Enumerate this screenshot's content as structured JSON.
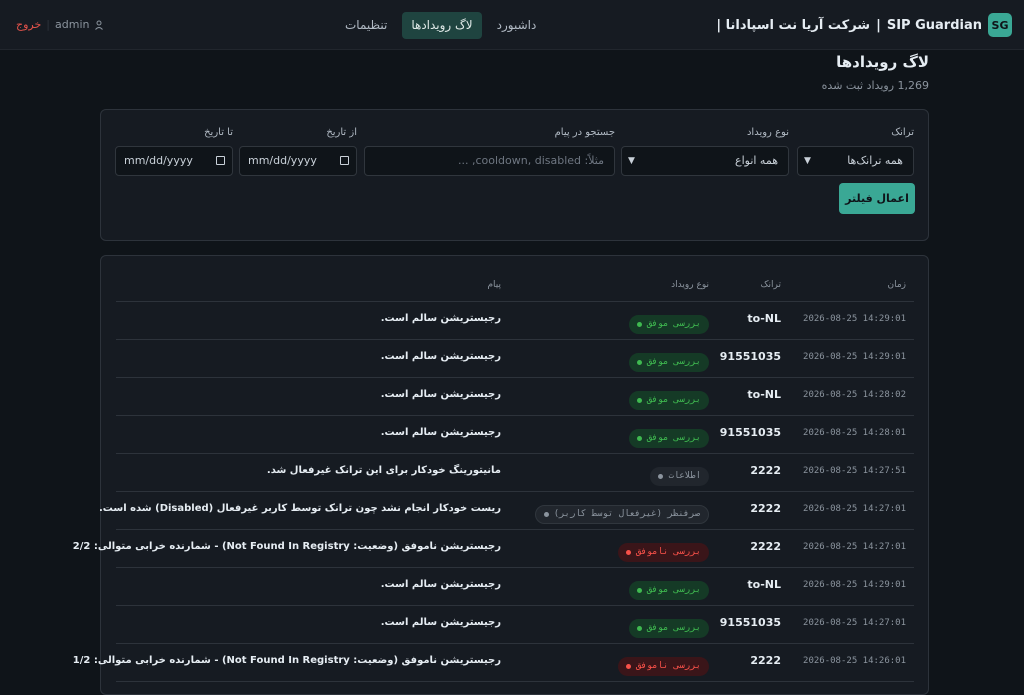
{
  "brand": {
    "logo": "SG",
    "name": "SIP Guardian",
    "separator": "|",
    "company": "شرکت آریا نت اسپادانا |"
  },
  "nav": {
    "tabs": [
      {
        "label": "داشبورد"
      },
      {
        "label": "لاگ رویدادها"
      },
      {
        "label": "تنظیمات"
      }
    ],
    "active_index": 1
  },
  "user": {
    "logout": "خروج",
    "name": "admin",
    "separator": "|",
    "icon": "user-icon"
  },
  "page": {
    "title": "لاگ رویدادها",
    "subtitle": "1,269 رویداد ثبت شده"
  },
  "filters": {
    "trunk": {
      "label": "ترانک",
      "value": "همه ترانک‌ها"
    },
    "type": {
      "label": "نوع رویداد",
      "value": "همه انواع"
    },
    "search": {
      "label": "جستجو در پیام",
      "placeholder": "مثلاً: cooldown, disabled, ..."
    },
    "from": {
      "label": "از تاریخ",
      "value": "mm/dd/yyyy"
    },
    "to": {
      "label": "تا تاریخ",
      "value": "mm/dd/yyyy"
    },
    "apply": "اعمال فیلتر"
  },
  "table": {
    "headers": {
      "time": "زمان",
      "trunk": "ترانک",
      "type": "نوع رویداد",
      "message": "پیام"
    },
    "rows": [
      {
        "time": "2026-08-25 14:29:01",
        "trunk": "to-NL",
        "type": "بررسی موفق",
        "status": "success",
        "message": "رجیستریشن سالم است."
      },
      {
        "time": "2026-08-25 14:29:01",
        "trunk": "91551035",
        "type": "بررسی موفق",
        "status": "success",
        "message": "رجیستریشن سالم است."
      },
      {
        "time": "2026-08-25 14:28:02",
        "trunk": "to-NL",
        "type": "بررسی موفق",
        "status": "success",
        "message": "رجیستریشن سالم است."
      },
      {
        "time": "2026-08-25 14:28:01",
        "trunk": "91551035",
        "type": "بررسی موفق",
        "status": "success",
        "message": "رجیستریشن سالم است."
      },
      {
        "time": "2026-08-25 14:27:51",
        "trunk": "2222",
        "type": "اطلاعات",
        "status": "info",
        "message": "مانیتورینگ خودکار برای این ترانک غیرفعال شد."
      },
      {
        "time": "2026-08-25 14:27:01",
        "trunk": "2222",
        "type": "صرفنظر (غیرفعال توسط کاربر)",
        "status": "skip",
        "message": "ریست خودکار انجام نشد چون ترانک توسط کاربر غیرفعال (Disabled) شده است."
      },
      {
        "time": "2026-08-25 14:27:01",
        "trunk": "2222",
        "type": "بررسی ناموفق",
        "status": "error",
        "message": "رجیستریشن ناموفق (وضعیت: Not Found In Registry) - شمارنده خرابی متوالی: 2/2"
      },
      {
        "time": "2026-08-25 14:29:01",
        "trunk": "to-NL",
        "type": "بررسی موفق",
        "status": "success",
        "message": "رجیستریشن سالم است."
      },
      {
        "time": "2026-08-25 14:27:01",
        "trunk": "91551035",
        "type": "بررسی موفق",
        "status": "success",
        "message": "رجیستریشن سالم است."
      },
      {
        "time": "2026-08-25 14:26:01",
        "trunk": "2222",
        "type": "بررسی ناموفق",
        "status": "error",
        "message": "رجیستریشن ناموفق (وضعیت: Not Found In Registry) - شمارنده خرابی متوالی: 1/2"
      }
    ]
  }
}
